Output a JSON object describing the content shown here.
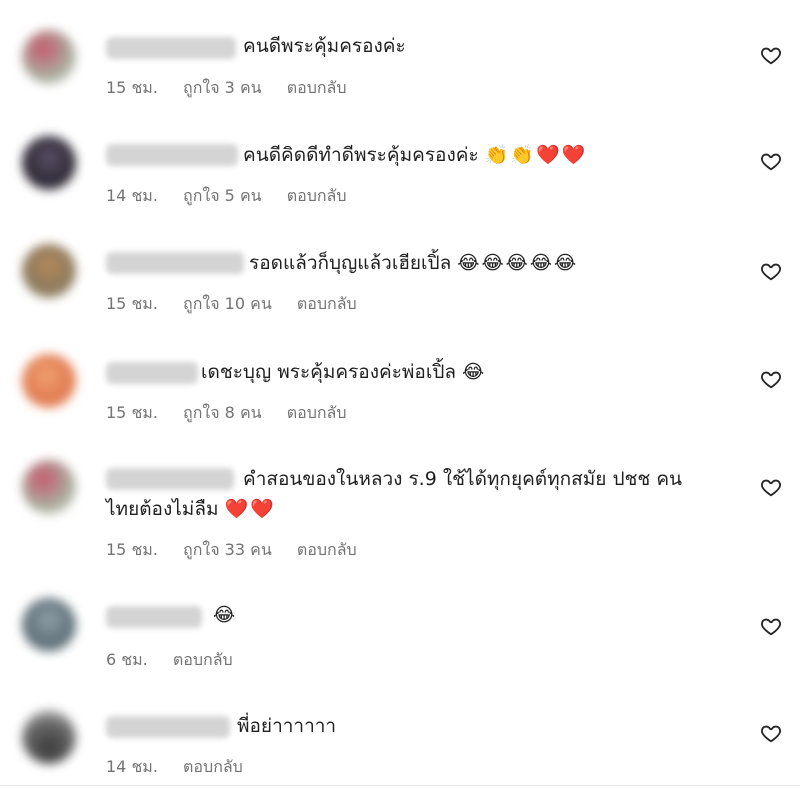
{
  "comments": [
    {
      "text": "คนดีพระคุ้มครองค่ะ",
      "emojis": "",
      "time": "15 ชม.",
      "likes": "ถูกใจ 3 คน",
      "reply": "ตอบกลับ"
    },
    {
      "text": "คนดีคิดดีทำดีพระคุ้มครองค่ะ",
      "emojis": "👏👏❤️❤️",
      "time": "14 ชม.",
      "likes": "ถูกใจ 5 คน",
      "reply": "ตอบกลับ"
    },
    {
      "text": "รอดแล้วก็บุญแล้วเฮียเปิ้ล",
      "emojis": "😂😂😂😂😂",
      "time": "15 ชม.",
      "likes": "ถูกใจ 10 คน",
      "reply": "ตอบกลับ"
    },
    {
      "text": "เดชะบุญ พระคุ้มครองค่ะพ่อเปิ้ล",
      "emojis": "😂",
      "time": "15 ชม.",
      "likes": "ถูกใจ 8 คน",
      "reply": "ตอบกลับ"
    },
    {
      "text": "คำสอนของในหลวง ร.9 ใช้ได้ทุกยุคต์ทุกสมัย ปชช คน",
      "text2": "ไทยต้องไม่ลืม",
      "emojis": "❤️❤️",
      "time": "15 ชม.",
      "likes": "ถูกใจ 33 คน",
      "reply": "ตอบกลับ"
    },
    {
      "text": "",
      "emojis": "😂",
      "time": "6 ชม.",
      "reply": "ตอบกลับ"
    },
    {
      "text": "พี่อย่าาาาาา",
      "emojis": "",
      "time": "14 ชม.",
      "reply": "ตอบกลับ"
    }
  ],
  "icons": {
    "like": "heart-outline-icon"
  },
  "colors": {
    "meta": "#737373",
    "text": "#1f1f1f"
  }
}
